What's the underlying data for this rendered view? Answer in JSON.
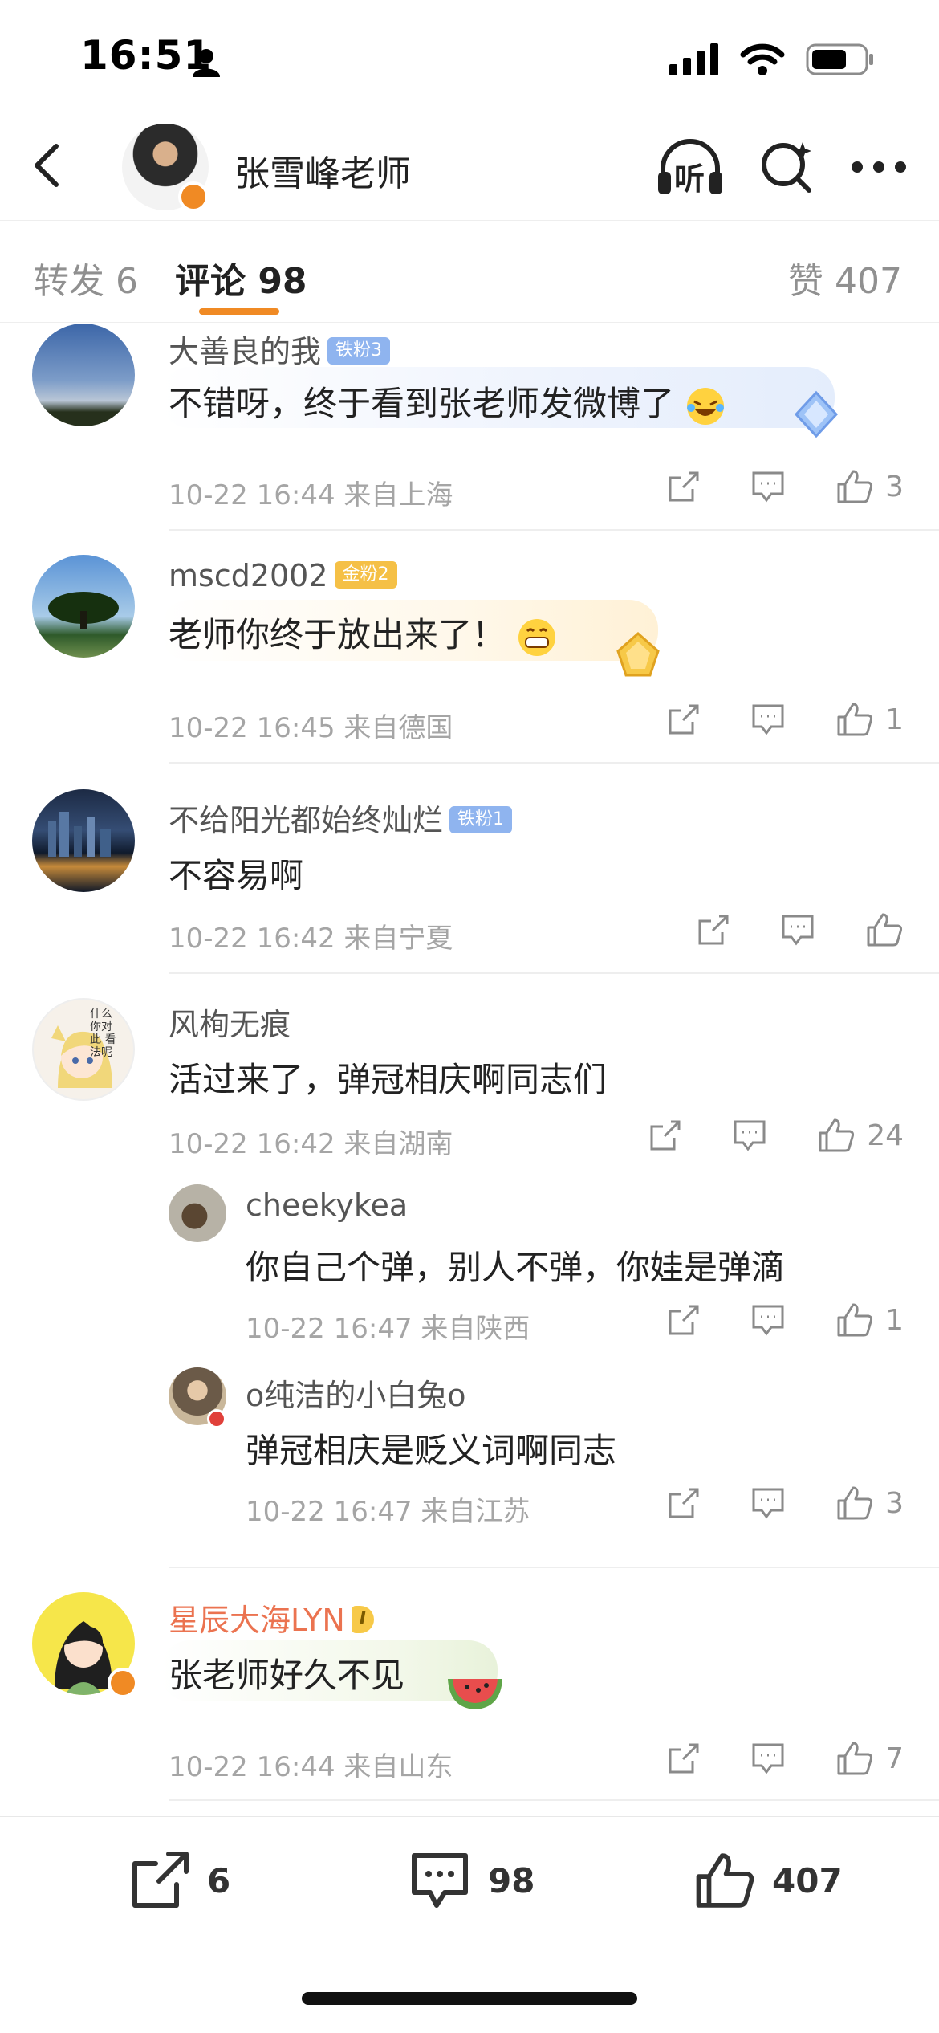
{
  "status_bar": {
    "time": "16:51"
  },
  "header": {
    "title": "张雪峰老师",
    "listen_label": "听"
  },
  "tabs": {
    "repost": "转发 6",
    "comments": "评论 98",
    "likes": "赞 407"
  },
  "comments": [
    {
      "username": "大善良的我",
      "badge": "铁粉3",
      "text": "不错呀，终于看到张老师发微博了",
      "emoji": "laughing-tears-emoji",
      "time": "10-22 16:44",
      "location": "来自上海",
      "likes": "3"
    },
    {
      "username": "mscd2002",
      "badge": "金粉2",
      "text": "老师你终于放出来了！",
      "emoji": "grinning-emoji",
      "time": "10-22 16:45",
      "location": "来自德国",
      "likes": "1"
    },
    {
      "username": "不给阳光都始终灿烂",
      "badge": "铁粉1",
      "text": "不容易啊",
      "time": "10-22 16:42",
      "location": "来自宁夏",
      "likes": ""
    },
    {
      "username": "风栒无痕",
      "text": "活过来了，弹冠相庆啊同志们",
      "time": "10-22 16:42",
      "location": "来自湖南",
      "likes": "24"
    },
    {
      "username": "cheekykea",
      "text": "你自己个弹，别人不弹，你娃是弹滴",
      "time": "10-22 16:47",
      "location": "来自陕西",
      "likes": "1"
    },
    {
      "username": "o纯洁的小白兔o",
      "text": "弹冠相庆是贬义词啊同志",
      "time": "10-22 16:47",
      "location": "来自江苏",
      "likes": "3"
    },
    {
      "username": "星辰大海LYN",
      "badge": "I",
      "text": "张老师好久不见",
      "emoji": "watermelon-sticker",
      "time": "10-22 16:44",
      "location": "来自山东",
      "likes": "7"
    }
  ],
  "avatar_cartoon_text": "什么 你对此 看法呢",
  "bottom_bar": {
    "reposts": "6",
    "comments": "98",
    "likes": "407"
  },
  "colors": {
    "accent": "#f08a24",
    "vip_name": "#eb7350",
    "iron_badge": "#8fb4ef",
    "gold_badge": "#f5c046"
  }
}
